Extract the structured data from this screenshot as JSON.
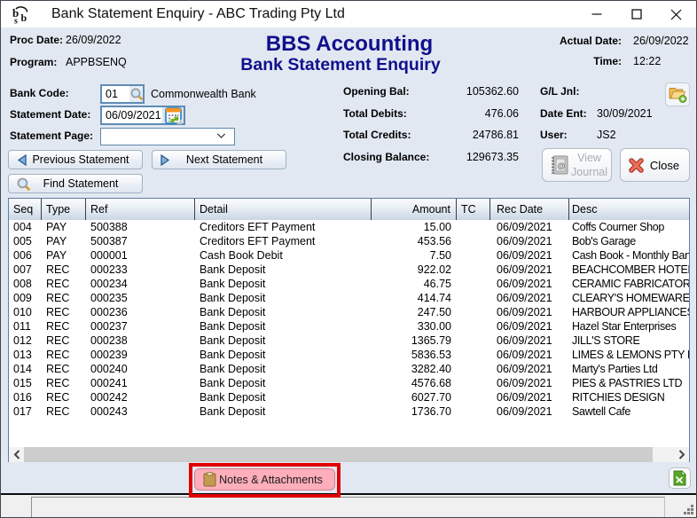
{
  "colors": {
    "bg": "#e2e8f2",
    "navy": "#10108c",
    "annotation_red": "#e00000",
    "notes_pink": "#ffaebb",
    "excel_green": "#58a628",
    "table_border": "#5c7ea3"
  },
  "window": {
    "title": "Bank Statement Enquiry - ABC Trading Pty Ltd"
  },
  "header": {
    "proc_date_label": "Proc Date:",
    "proc_date": "26/09/2022",
    "program_label": "Program:",
    "program": "APPBSENQ",
    "app_title": "BBS Accounting",
    "screen_title": "Bank Statement Enquiry",
    "actual_date_label": "Actual Date:",
    "actual_date": "26/09/2022",
    "time_label": "Time:",
    "time": "12:22"
  },
  "form": {
    "bank_code_label": "Bank Code:",
    "bank_code": "01",
    "bank_name": "Commonwealth Bank",
    "statement_date_label": "Statement Date:",
    "statement_date": "06/09/2021",
    "statement_page_label": "Statement Page:",
    "statement_page": "",
    "previous_button": "Previous Statement",
    "next_button": "Next Statement",
    "find_button": "Find Statement"
  },
  "summary": {
    "opening_bal_label": "Opening Bal:",
    "opening_bal": "105362.60",
    "total_debits_label": "Total Debits:",
    "total_debits": "476.06",
    "total_credits_label": "Total Credits:",
    "total_credits": "24786.81",
    "closing_balance_label": "Closing Balance:",
    "closing_balance": "129673.35"
  },
  "journal": {
    "gl_jnl_label": "G/L Jnl:",
    "date_ent_label": "Date Ent:",
    "date_ent": "30/09/2021",
    "user_label": "User:",
    "user": "JS2",
    "view_journal_button": "View Journal",
    "close_button": "Close"
  },
  "table": {
    "columns": [
      "Seq",
      "Type",
      "Ref",
      "Detail",
      "Amount",
      "TC",
      "Rec Date",
      "Desc"
    ],
    "rows": [
      [
        "004",
        "PAY",
        "500388",
        "Creditors EFT Payment",
        "15.00",
        "",
        "06/09/2021",
        "Coffs Courner Shop"
      ],
      [
        "005",
        "PAY",
        "500387",
        "Creditors EFT Payment",
        "453.56",
        "",
        "06/09/2021",
        "Bob's Garage"
      ],
      [
        "006",
        "PAY",
        "000001",
        "Cash Book Debit",
        "7.50",
        "",
        "06/09/2021",
        "Cash Book - Monthly Bank"
      ],
      [
        "007",
        "REC",
        "000233",
        "Bank Deposit",
        "922.02",
        "",
        "06/09/2021",
        "BEACHCOMBER HOTEL"
      ],
      [
        "008",
        "REC",
        "000234",
        "Bank Deposit",
        "46.75",
        "",
        "06/09/2021",
        "CERAMIC FABRICATORS"
      ],
      [
        "009",
        "REC",
        "000235",
        "Bank Deposit",
        "414.74",
        "",
        "06/09/2021",
        "CLEARY'S HOMEWARES"
      ],
      [
        "010",
        "REC",
        "000236",
        "Bank Deposit",
        "247.50",
        "",
        "06/09/2021",
        "HARBOUR APPLIANCES"
      ],
      [
        "011",
        "REC",
        "000237",
        "Bank Deposit",
        "330.00",
        "",
        "06/09/2021",
        "Hazel Star Enterprises"
      ],
      [
        "012",
        "REC",
        "000238",
        "Bank Deposit",
        "1365.79",
        "",
        "06/09/2021",
        "JILL'S STORE"
      ],
      [
        "013",
        "REC",
        "000239",
        "Bank Deposit",
        "5836.53",
        "",
        "06/09/2021",
        "LIMES & LEMONS PTY LTD"
      ],
      [
        "014",
        "REC",
        "000240",
        "Bank Deposit",
        "3282.40",
        "",
        "06/09/2021",
        "Marty's Parties Ltd"
      ],
      [
        "015",
        "REC",
        "000241",
        "Bank Deposit",
        "4576.68",
        "",
        "06/09/2021",
        "PIES & PASTRIES LTD"
      ],
      [
        "016",
        "REC",
        "000242",
        "Bank Deposit",
        "6027.70",
        "",
        "06/09/2021",
        "RITCHIES DESIGN"
      ],
      [
        "017",
        "REC",
        "000243",
        "Bank Deposit",
        "1736.70",
        "",
        "06/09/2021",
        "Sawtell Cafe"
      ]
    ]
  },
  "footer": {
    "notes_button": "Notes & Attachments"
  }
}
